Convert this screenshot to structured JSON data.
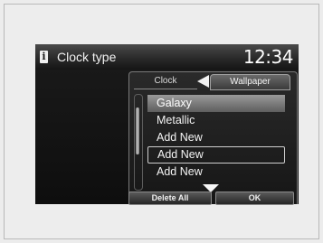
{
  "header": {
    "title": "Clock type",
    "time": "12:34",
    "info_icon": "info-icon"
  },
  "tabs": [
    {
      "label": "Clock",
      "active": false
    },
    {
      "label": "Wallpaper",
      "active": true
    }
  ],
  "wallpaper_list": [
    {
      "label": "Galaxy",
      "state": "highlighted"
    },
    {
      "label": "Metallic",
      "state": "normal"
    },
    {
      "label": "Add New",
      "state": "normal"
    },
    {
      "label": "Add New",
      "state": "selected"
    },
    {
      "label": "Add New",
      "state": "normal"
    }
  ],
  "buttons": {
    "delete_all": "Delete All",
    "ok": "OK"
  },
  "colors": {
    "screen_bg": "#141414",
    "highlight": "#7c7c7c",
    "text": "#f4f4f4"
  }
}
